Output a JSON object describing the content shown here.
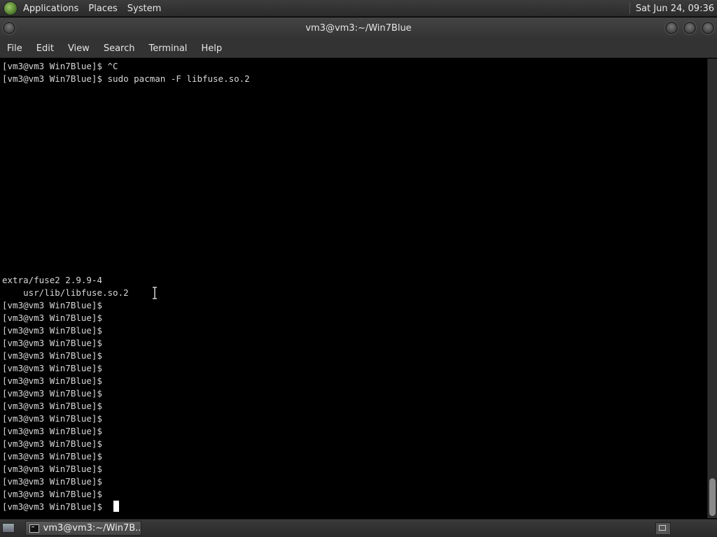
{
  "top_panel": {
    "menus": [
      "Applications",
      "Places",
      "System"
    ],
    "clock": "Sat Jun 24, 09:36"
  },
  "window": {
    "title": "vm3@vm3:~/Win7Blue"
  },
  "menubar": [
    "File",
    "Edit",
    "View",
    "Search",
    "Terminal",
    "Help"
  ],
  "terminal": {
    "lines": [
      "[vm3@vm3 Win7Blue]$ ^C",
      "[vm3@vm3 Win7Blue]$ sudo pacman -F libfuse.so.2",
      "extra/fuse2 2.9.9-4",
      "    usr/lib/libfuse.so.2",
      "[vm3@vm3 Win7Blue]$",
      "[vm3@vm3 Win7Blue]$",
      "[vm3@vm3 Win7Blue]$",
      "[vm3@vm3 Win7Blue]$",
      "[vm3@vm3 Win7Blue]$",
      "[vm3@vm3 Win7Blue]$",
      "[vm3@vm3 Win7Blue]$",
      "[vm3@vm3 Win7Blue]$",
      "[vm3@vm3 Win7Blue]$",
      "[vm3@vm3 Win7Blue]$",
      "[vm3@vm3 Win7Blue]$",
      "[vm3@vm3 Win7Blue]$",
      "[vm3@vm3 Win7Blue]$",
      "[vm3@vm3 Win7Blue]$",
      "[vm3@vm3 Win7Blue]$",
      "[vm3@vm3 Win7Blue]$",
      "[vm3@vm3 Win7Blue]$ "
    ]
  },
  "taskbar": {
    "task_label": "vm3@vm3:~/Win7B..."
  }
}
